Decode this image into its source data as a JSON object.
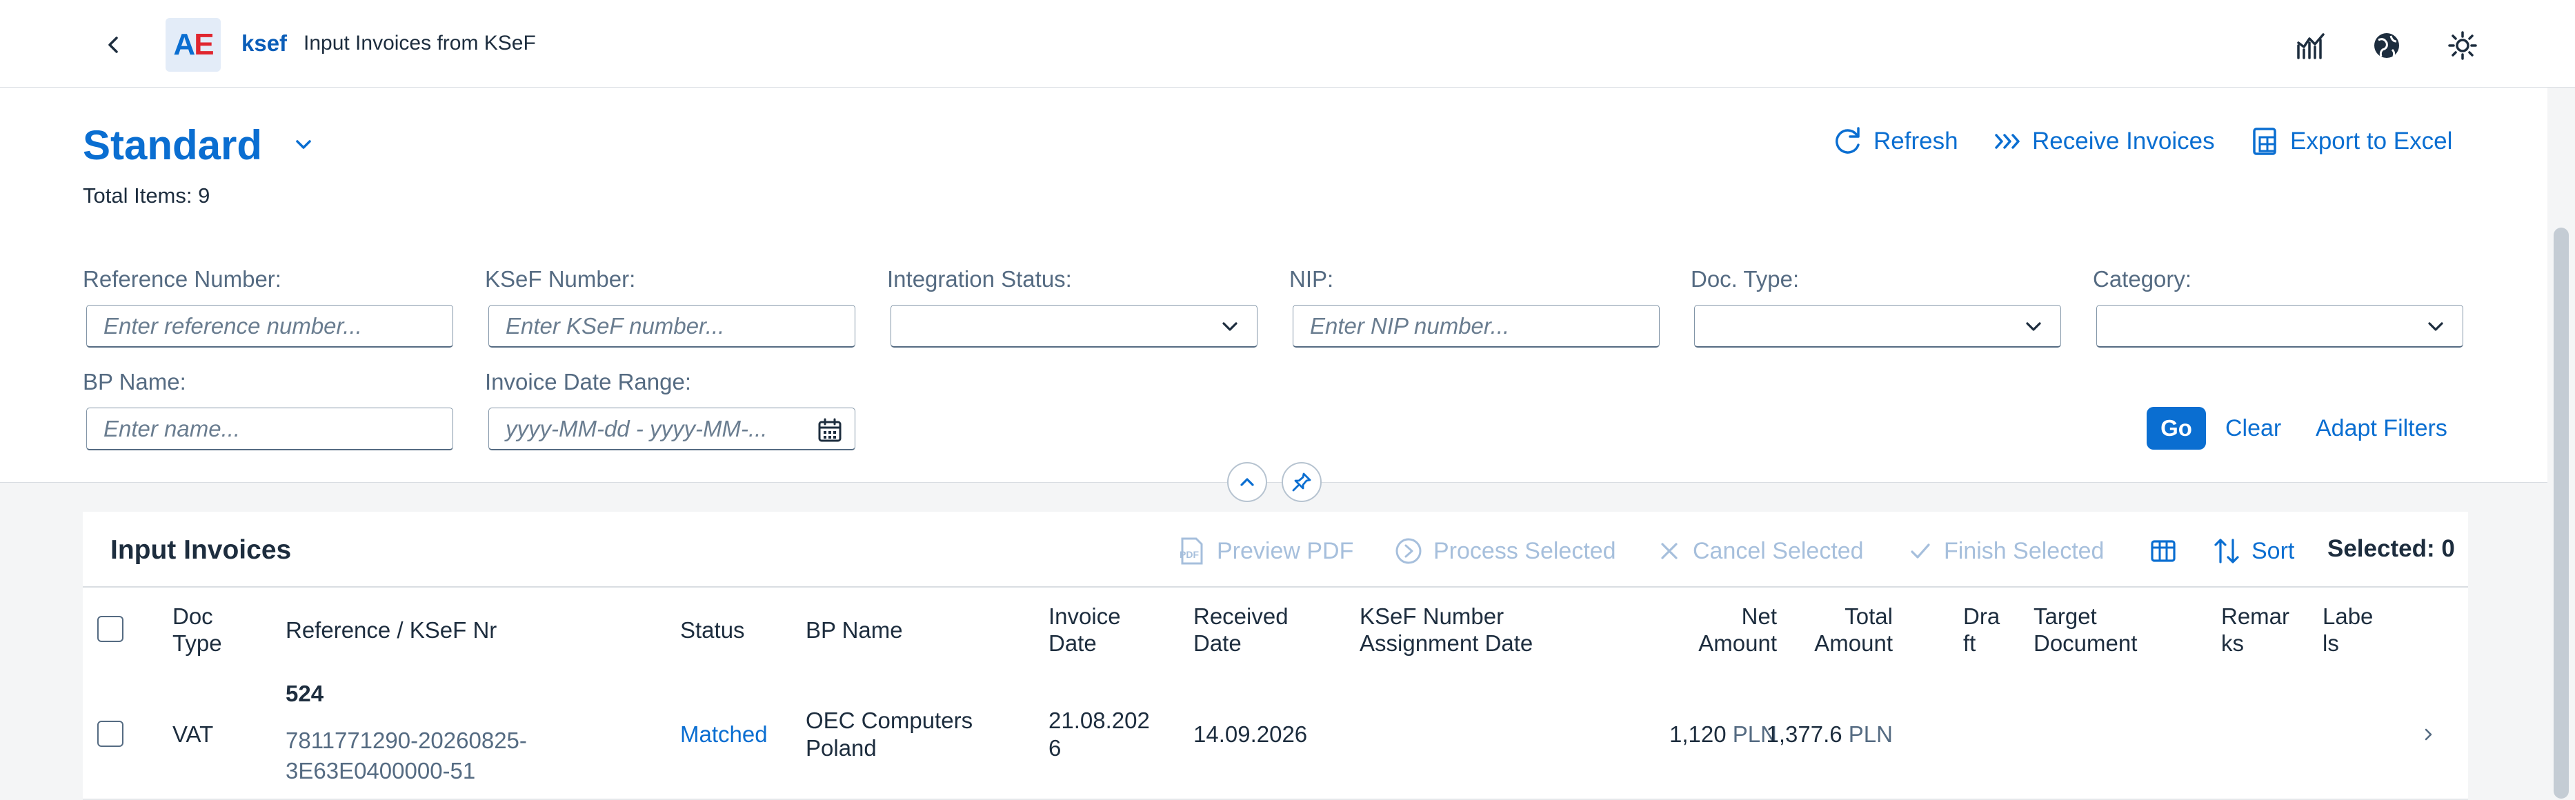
{
  "shell": {
    "app_short": "ksef",
    "app_title": "Input Invoices from KSeF",
    "logo_a": "A",
    "logo_e": "E",
    "icons": [
      "back-icon",
      "analytics-icon",
      "globe-icon",
      "theme-icon"
    ]
  },
  "header": {
    "variant": "Standard",
    "total_items": "Total Items: 9",
    "actions": {
      "refresh": "Refresh",
      "receive": "Receive Invoices",
      "export": "Export to Excel"
    }
  },
  "filters": {
    "reference_label": "Reference Number:",
    "reference_placeholder": "Enter reference number...",
    "ksef_label": "KSeF Number:",
    "ksef_placeholder": "Enter KSeF number...",
    "integration_label": "Integration Status:",
    "nip_label": "NIP:",
    "nip_placeholder": "Enter NIP number...",
    "doctype_label": "Doc. Type:",
    "category_label": "Category:",
    "bpname_label": "BP Name:",
    "bpname_placeholder": "Enter name...",
    "daterange_label": "Invoice Date Range:",
    "daterange_placeholder": "yyyy-MM-dd - yyyy-MM-...",
    "go": "Go",
    "clear": "Clear",
    "adapt": "Adapt Filters"
  },
  "table": {
    "title": "Input Invoices",
    "actions": {
      "preview_pdf": "Preview PDF",
      "process_selected": "Process Selected",
      "cancel_selected": "Cancel Selected",
      "finish_selected": "Finish Selected",
      "sort": "Sort"
    },
    "selected": "Selected: 0",
    "columns": {
      "doc_type": [
        "Doc",
        "Type"
      ],
      "reference": "Reference / KSeF Nr",
      "status": "Status",
      "bp_name": "BP Name",
      "invoice_date": [
        "Invoice",
        "Date"
      ],
      "received_date": [
        "Received",
        "Date"
      ],
      "ksef_assign": [
        "KSeF Number",
        "Assignment Date"
      ],
      "net_amount": [
        "Net",
        "Amount"
      ],
      "total_amount": [
        "Total",
        "Amount"
      ],
      "draft": [
        "Dra",
        "ft"
      ],
      "target_doc": [
        "Target",
        "Document"
      ],
      "remarks": [
        "Remar",
        "ks"
      ],
      "labels": [
        "Labe",
        "ls"
      ]
    },
    "rows": [
      {
        "doc_type": "VAT",
        "reference": "524",
        "ksef_nr": [
          "7811771290-20260825-",
          "3E63E0400000-51"
        ],
        "status": "Matched",
        "bp_name": [
          "OEC Computers",
          "Poland"
        ],
        "invoice_date": [
          "21.08.202",
          "6"
        ],
        "received_date": "14.09.2026",
        "net_amount": "1,120",
        "net_currency": "PLN",
        "total_amount": "1,377.6",
        "total_currency": "PLN"
      }
    ]
  }
}
